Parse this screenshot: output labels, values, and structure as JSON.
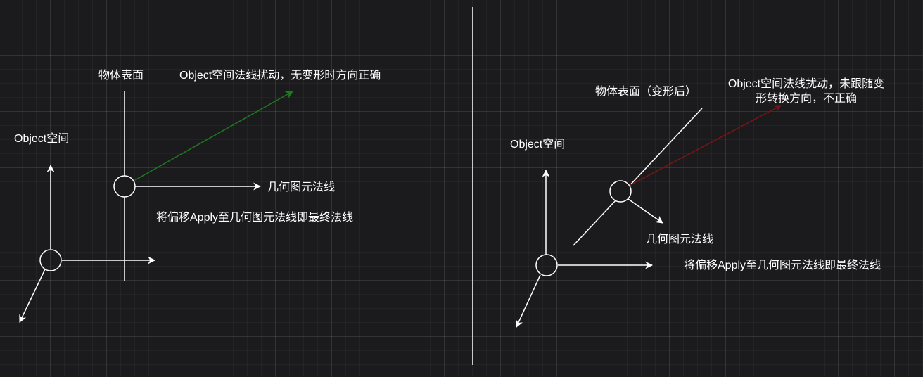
{
  "left_panel": {
    "object_space_label": "Object空间",
    "surface_label": "物体表面",
    "perturb_label": "Object空间法线扰动，无变形时方向正确",
    "geo_normal_label": "几何图元法线",
    "apply_label": "将偏移Apply至几何图元法线即最终法线"
  },
  "right_panel": {
    "object_space_label": "Object空间",
    "surface_label": "物体表面（变形后）",
    "perturb_label_line1": "Object空间法线扰动，未跟随变",
    "perturb_label_line2": "形转换方向，不正确",
    "geo_normal_label": "几何图元法线",
    "apply_label": "将偏移Apply至几何图元法线即最终法线"
  },
  "colors": {
    "background": "#1b1b1d",
    "stroke": "#ffffff",
    "correct_arrow": "#1e7a1e",
    "incorrect_arrow": "#7a1414"
  }
}
